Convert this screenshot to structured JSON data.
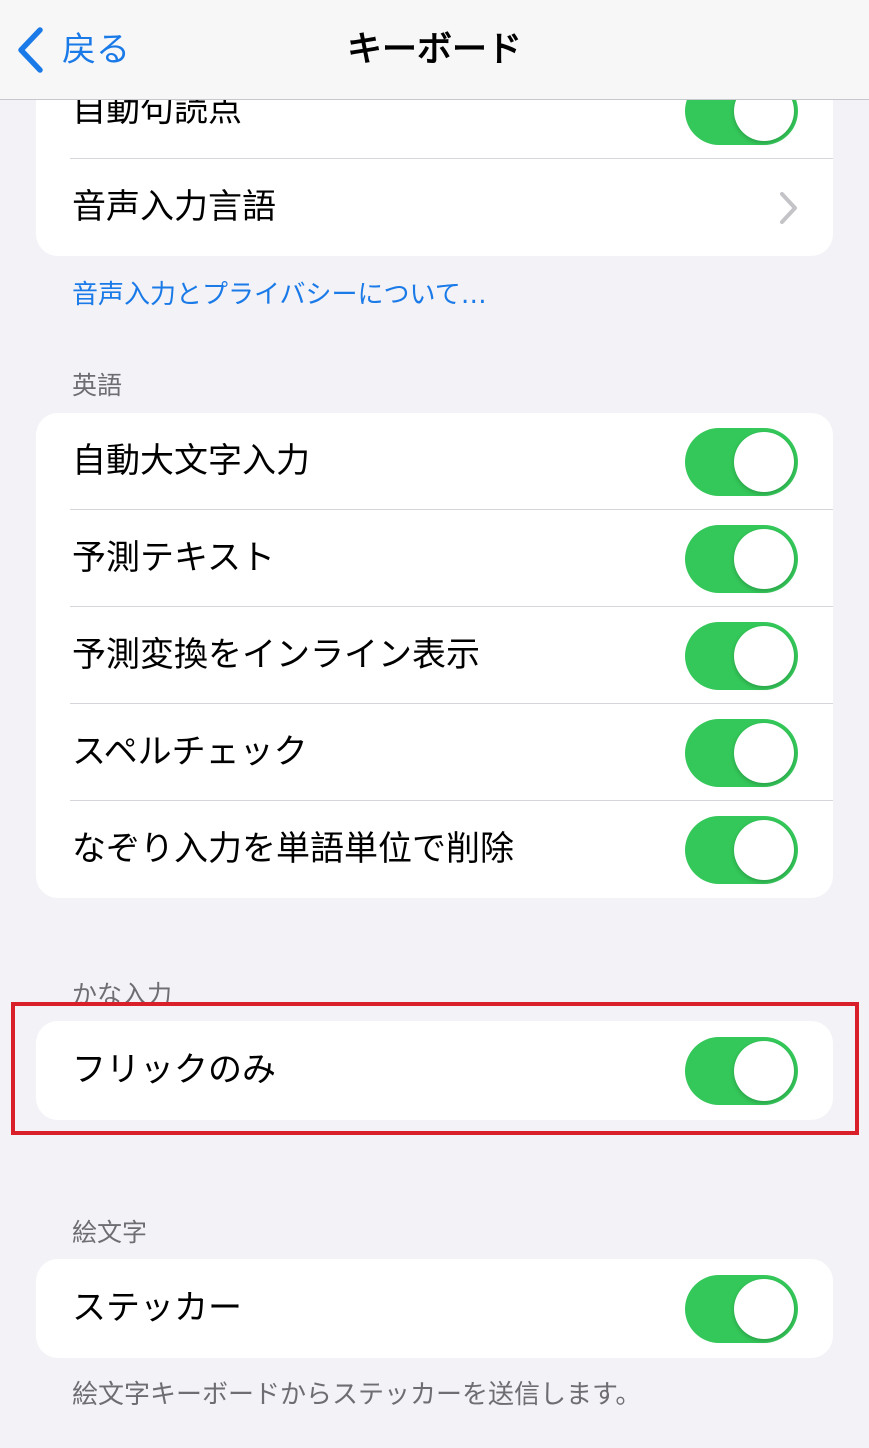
{
  "nav": {
    "back_label": "戻る",
    "title": "キーボード"
  },
  "colors": {
    "accent": "#1a7ae8",
    "toggle_on": "#34c759",
    "highlight": "#d9202a"
  },
  "group_voice": {
    "items": [
      {
        "label": "自動句読点",
        "control": "toggle",
        "state": "on"
      },
      {
        "label": "音声入力言語",
        "control": "chevron-right-icon"
      }
    ],
    "footer_link": "音声入力とプライバシーについて…"
  },
  "english": {
    "header": "英語",
    "items": [
      {
        "label": "自動大文字入力",
        "state": "on"
      },
      {
        "label": "予測テキスト",
        "state": "on"
      },
      {
        "label": "予測変換をインライン表示",
        "state": "on"
      },
      {
        "label": "スペルチェック",
        "state": "on"
      },
      {
        "label": "なぞり入力を単語単位で削除",
        "state": "on"
      }
    ]
  },
  "kana": {
    "header": "かな入力",
    "items": [
      {
        "label": "フリックのみ",
        "state": "on"
      }
    ]
  },
  "emoji": {
    "header": "絵文字",
    "items": [
      {
        "label": "ステッカー",
        "state": "on"
      }
    ],
    "footer": "絵文字キーボードからステッカーを送信します。"
  }
}
